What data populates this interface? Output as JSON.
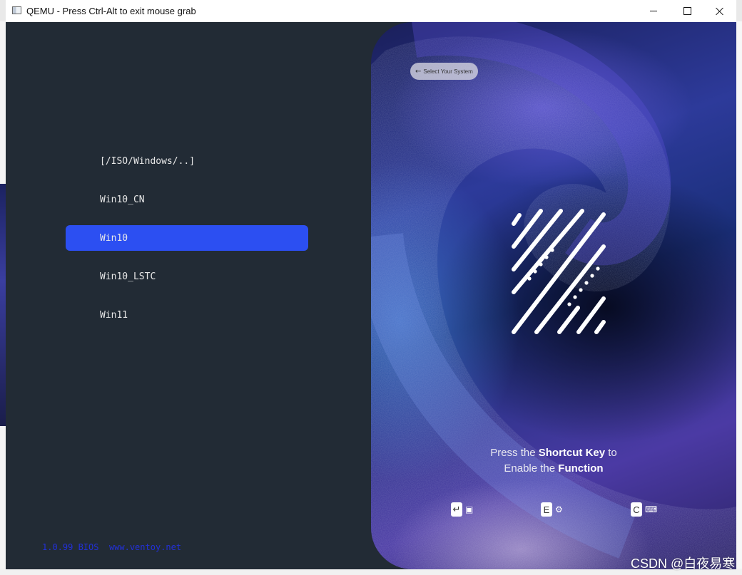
{
  "window": {
    "title": "QEMU - Press Ctrl-Alt to exit mouse grab"
  },
  "menu": {
    "items": [
      {
        "label": "[/ISO/Windows/..]",
        "selected": false
      },
      {
        "label": "Win10_CN",
        "selected": false
      },
      {
        "label": "Win10",
        "selected": true
      },
      {
        "label": "Win10_LSTC",
        "selected": false
      },
      {
        "label": "Win11",
        "selected": false
      }
    ],
    "highlight_color": "#2c4ff2"
  },
  "footer": {
    "version": "1.0.99 BIOS",
    "website": "www.ventoy.net"
  },
  "art": {
    "back_label": "Select Your System",
    "prompt_pre": "Press the ",
    "prompt_key": "Shortcut Key",
    "prompt_to": " to",
    "prompt_line2_pre": "Enable the ",
    "prompt_function": "Function",
    "keys": [
      {
        "key": "↵",
        "icon": "boot-icon"
      },
      {
        "key": "E",
        "icon": "gear-icon"
      },
      {
        "key": "C",
        "icon": "terminal-icon"
      }
    ]
  },
  "watermark": "CSDN @白夜易寒",
  "colors": {
    "screen_bg": "#222b35",
    "footer_text": "#2230d8"
  }
}
